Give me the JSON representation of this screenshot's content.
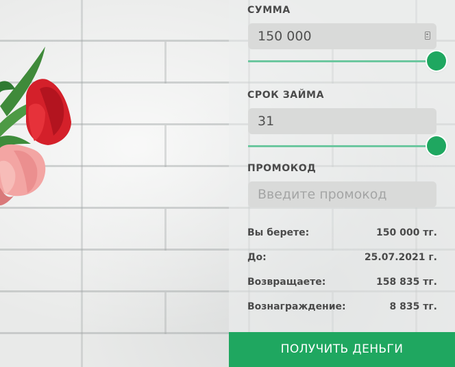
{
  "form": {
    "amount": {
      "label": "СУММА",
      "value": "150 000",
      "slider_fraction": 1.0,
      "icon": "calculator-icon"
    },
    "term": {
      "label": "СРОК ЗАЙМА",
      "value": "31",
      "slider_fraction": 1.0
    },
    "promo": {
      "label": "ПРОМОКОД",
      "placeholder": "Введите промокод",
      "value": ""
    }
  },
  "summary": [
    {
      "key": "Вы берете:",
      "value": "150 000 тг."
    },
    {
      "key": "До:",
      "value": "25.07.2021 г."
    },
    {
      "key": "Возвращаете:",
      "value": "158 835 тг."
    },
    {
      "key": "Вознаграждение:",
      "value": "8 835 тг."
    }
  ],
  "cta": {
    "label": "ПОЛУЧИТЬ ДЕНЬГИ"
  },
  "colors": {
    "accent": "#1fa760",
    "slider_track": "#8fd1b3",
    "field_bg": "#d9dad9",
    "text": "#4a4a4a"
  }
}
